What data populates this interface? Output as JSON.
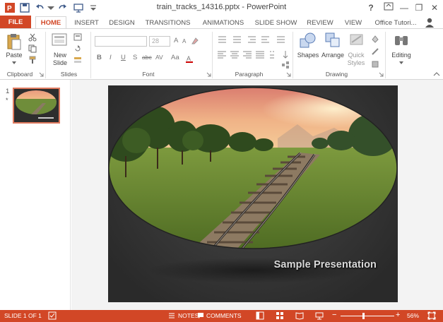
{
  "window": {
    "title": "train_tracks_14316.pptx - PowerPoint",
    "help": "?",
    "minimize": "—",
    "restore": "❐",
    "close": "✕"
  },
  "tabs": {
    "file": "FILE",
    "home": "HOME",
    "insert": "INSERT",
    "design": "DESIGN",
    "transitions": "TRANSITIONS",
    "animations": "ANIMATIONS",
    "slide_show": "SLIDE SHOW",
    "review": "REVIEW",
    "view": "VIEW",
    "account": "Office Tutori..."
  },
  "ribbon": {
    "clipboard": {
      "paste": "Paste",
      "label": "Clipboard"
    },
    "slides": {
      "new_slide": "New Slide",
      "label": "Slides"
    },
    "font": {
      "size": "28",
      "bold": "B",
      "italic": "I",
      "underline": "U",
      "strike": "S",
      "shadow": "abc",
      "spacing": "AV",
      "case": "Aa",
      "grow": "A",
      "shrink": "A",
      "label": "Font"
    },
    "paragraph": {
      "label": "Paragraph"
    },
    "drawing": {
      "shapes": "Shapes",
      "arrange": "Arrange",
      "quick_styles": "Quick Styles",
      "label": "Drawing"
    },
    "editing": {
      "label": "Editing"
    }
  },
  "thumbnails": [
    {
      "number": "1",
      "marker": "*"
    }
  ],
  "slide": {
    "title": "Sample Presentation"
  },
  "status": {
    "slide_count": "SLIDE 1 OF 1",
    "notes": "NOTES",
    "comments": "COMMENTS",
    "zoom": "56%"
  },
  "colors": {
    "accent": "#d24726",
    "ribbon_bg": "#ffffff",
    "canvas_bg": "#f3f3f3",
    "slide_bg": "#2e2e2e"
  }
}
